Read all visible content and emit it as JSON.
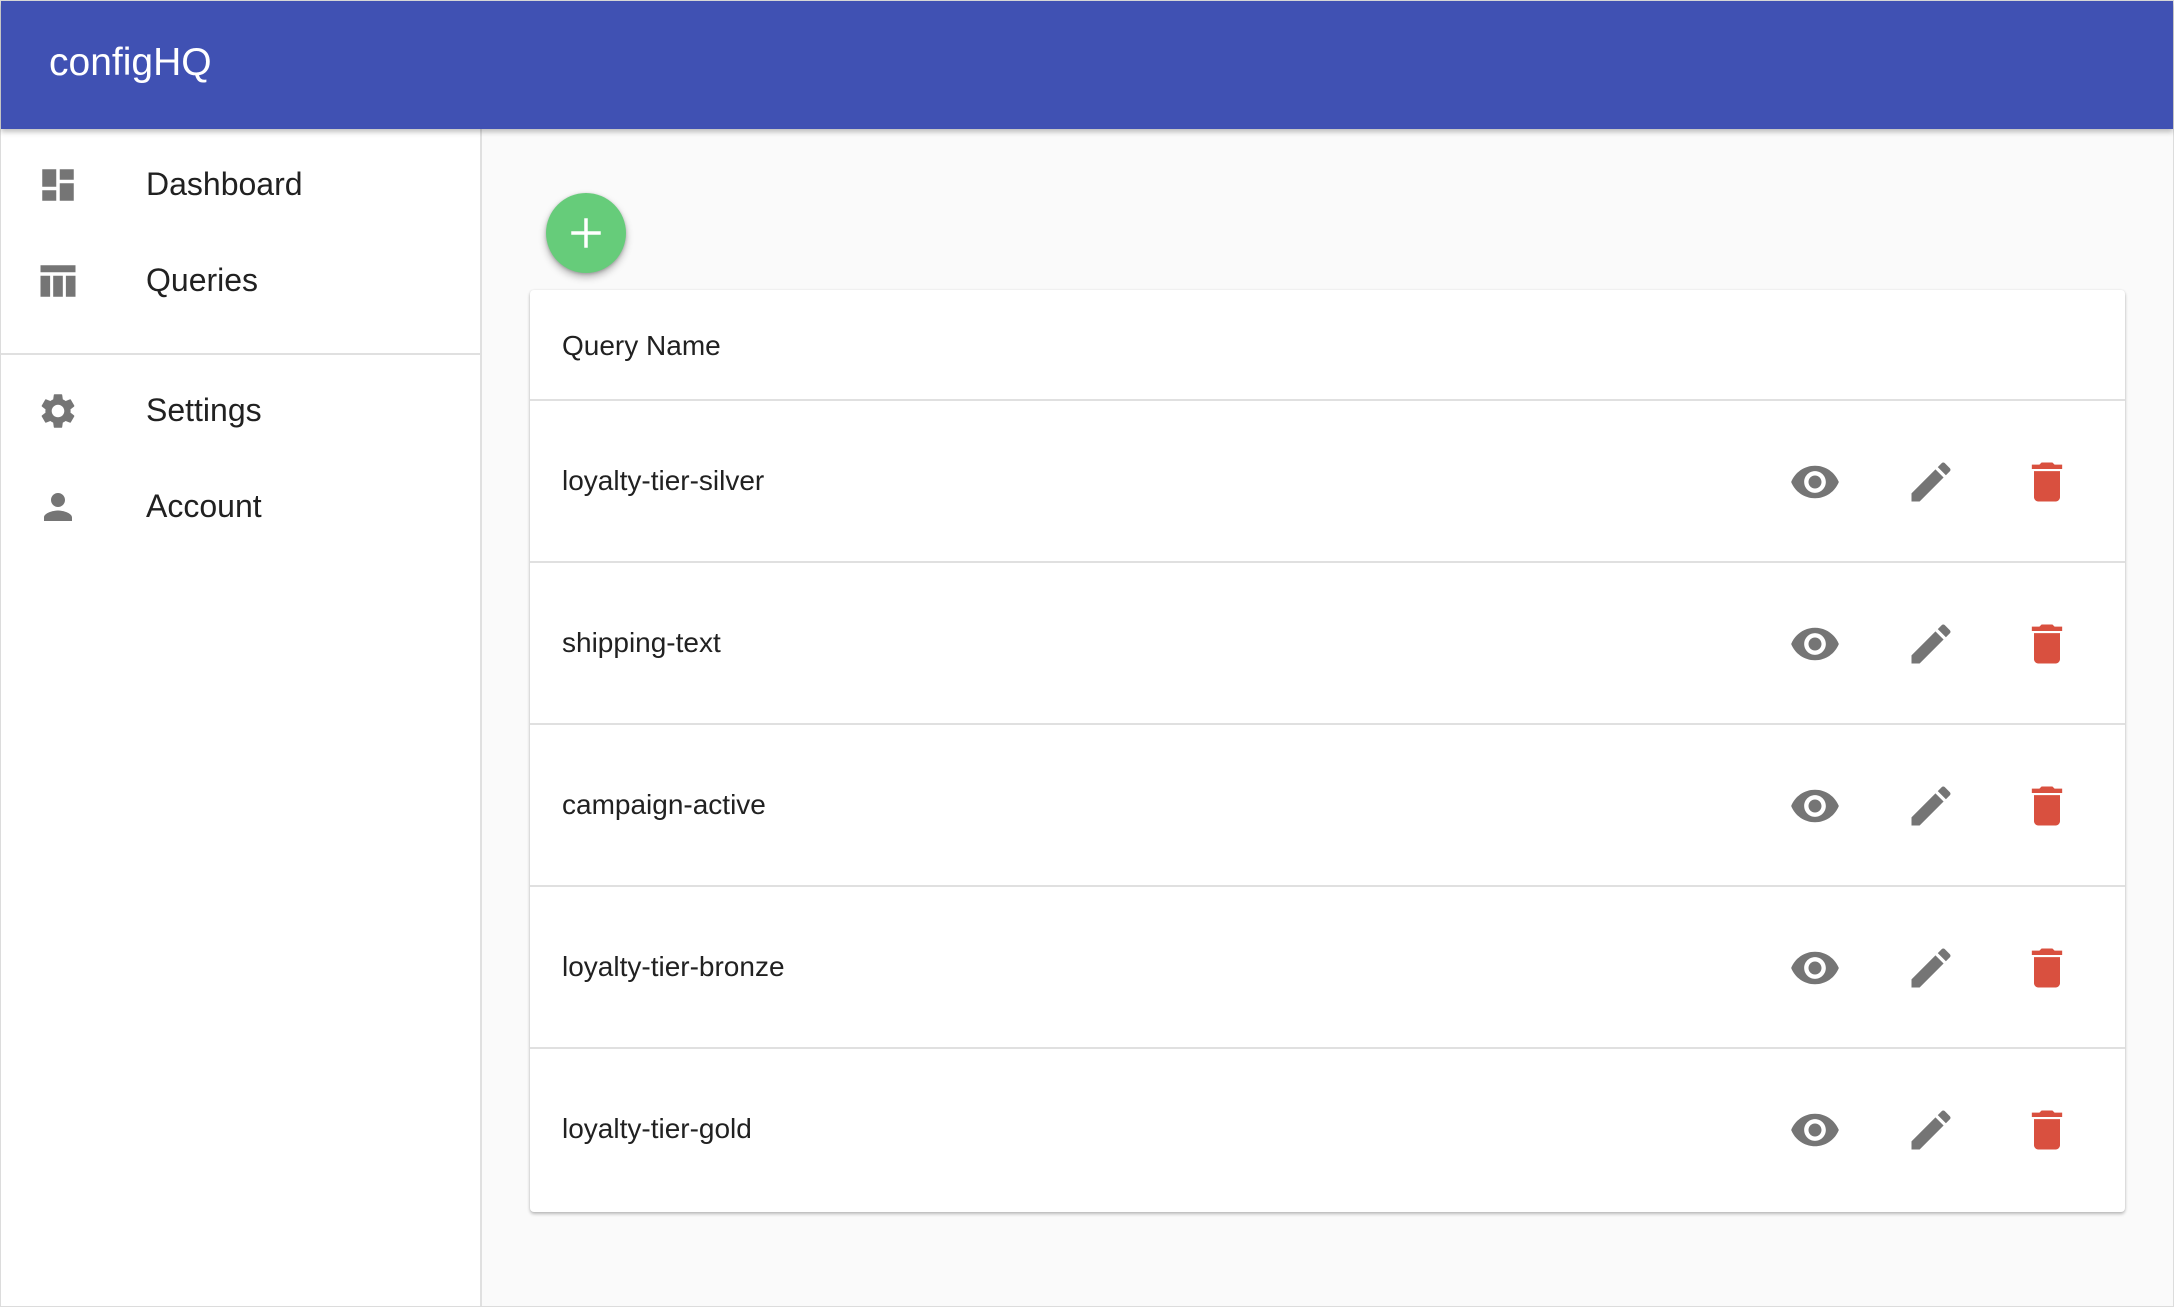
{
  "app": {
    "title": "configHQ"
  },
  "sidebar": {
    "items": [
      {
        "label": "Dashboard",
        "icon": "dashboard-icon"
      },
      {
        "label": "Queries",
        "icon": "table-icon"
      },
      {
        "label": "Settings",
        "icon": "gear-icon"
      },
      {
        "label": "Account",
        "icon": "person-icon"
      }
    ]
  },
  "main": {
    "add_button_icon": "plus-icon",
    "table": {
      "column_header": "Query Name",
      "rows": [
        {
          "name": "loyalty-tier-silver"
        },
        {
          "name": "shipping-text"
        },
        {
          "name": "campaign-active"
        },
        {
          "name": "loyalty-tier-bronze"
        },
        {
          "name": "loyalty-tier-gold"
        }
      ],
      "actions": [
        "eye-icon",
        "pencil-icon",
        "trash-icon"
      ]
    }
  },
  "colors": {
    "app_bar": "#4051b3",
    "fab": "#66cc7a",
    "icon_gray": "#757575",
    "delete_red": "#d9503f",
    "background": "#fafafa"
  }
}
